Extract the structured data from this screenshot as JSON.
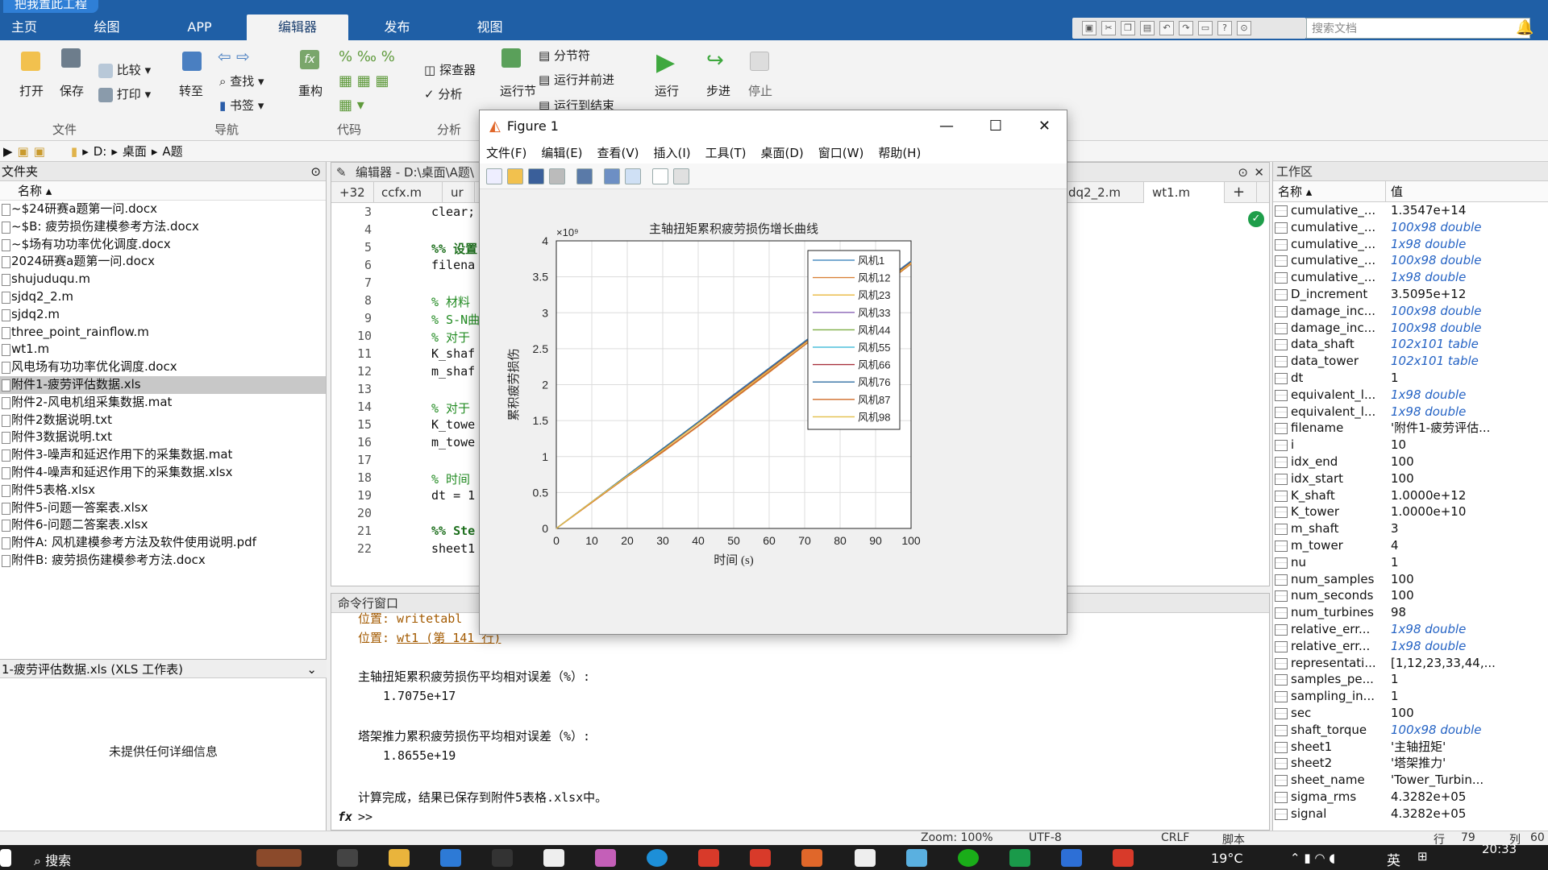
{
  "app": {
    "title_tag": "把我置此工程"
  },
  "tabs": [
    {
      "label": "主页",
      "active": false
    },
    {
      "label": "绘图",
      "active": false
    },
    {
      "label": "APP",
      "active": false
    },
    {
      "label": "编辑器",
      "active": true
    },
    {
      "label": "发布",
      "active": false
    },
    {
      "label": "视图",
      "active": false
    }
  ],
  "search": {
    "placeholder": "搜索文档"
  },
  "ribbon": {
    "open": "打开",
    "save": "保存",
    "compare": "比较",
    "print": "打印",
    "goto": "转至",
    "find": "查找",
    "bookmark": "书签",
    "refactor": "重构",
    "profiler": "探查器",
    "analyze": "分析",
    "run_section": "运行节",
    "section_break": "分节符",
    "run_advance": "运行并前进",
    "run_to_end": "运行到结束",
    "run": "运行",
    "step": "步进",
    "stop": "停止",
    "groups": [
      "文件",
      "导航",
      "代码",
      "分析"
    ]
  },
  "address": {
    "drive": "D:",
    "folder1": "桌面",
    "folder2": "A题"
  },
  "file_panel": {
    "title": "文件夹",
    "col_name": "名称",
    "files": [
      {
        "name": "~$24研赛a题第一问.docx",
        "selected": false
      },
      {
        "name": "~$B: 疲劳损伤建模参考方法.docx",
        "selected": false
      },
      {
        "name": "~$场有功功率优化调度.docx",
        "selected": false
      },
      {
        "name": "2024研赛a题第一问.docx",
        "selected": false
      },
      {
        "name": "shujuduqu.m",
        "selected": false
      },
      {
        "name": "sjdq2_2.m",
        "selected": false
      },
      {
        "name": "sjdq2.m",
        "selected": false
      },
      {
        "name": "three_point_rainflow.m",
        "selected": false
      },
      {
        "name": "wt1.m",
        "selected": false
      },
      {
        "name": "风电场有功功率优化调度.docx",
        "selected": false
      },
      {
        "name": "附件1-疲劳评估数据.xls",
        "selected": true
      },
      {
        "name": "附件2-风电机组采集数据.mat",
        "selected": false
      },
      {
        "name": "附件2数据说明.txt",
        "selected": false
      },
      {
        "name": "附件3数据说明.txt",
        "selected": false
      },
      {
        "name": "附件3-噪声和延迟作用下的采集数据.mat",
        "selected": false
      },
      {
        "name": "附件4-噪声和延迟作用下的采集数据.xlsx",
        "selected": false
      },
      {
        "name": "附件5表格.xlsx",
        "selected": false
      },
      {
        "name": "附件5-问题一答案表.xlsx",
        "selected": false
      },
      {
        "name": "附件6-问题二答案表.xlsx",
        "selected": false
      },
      {
        "name": "附件A: 风机建模参考方法及软件使用说明.pdf",
        "selected": false
      },
      {
        "name": "附件B: 疲劳损伤建模参考方法.docx",
        "selected": false
      }
    ],
    "detail_title": "1-疲劳评估数据.xls (XLS 工作表)",
    "detail_text": "未提供任何详细信息"
  },
  "editor": {
    "header": "编辑器 - D:\\桌面\\A题\\",
    "tabs": [
      {
        "label": "+32"
      },
      {
        "label": "ccfx.m"
      },
      {
        "label": "ur"
      },
      {
        "label": "dq2_2.m"
      },
      {
        "label": "wt1.m"
      }
    ],
    "lines": [
      {
        "n": "3",
        "code": "clear;"
      },
      {
        "n": "4",
        "code": ""
      },
      {
        "n": "5",
        "code": "%% 设置"
      },
      {
        "n": "6",
        "code": "filena"
      },
      {
        "n": "7",
        "code": ""
      },
      {
        "n": "8",
        "code": "% 材料"
      },
      {
        "n": "9",
        "code": "% S-N曲"
      },
      {
        "n": "10",
        "code": "% 对于"
      },
      {
        "n": "11",
        "code": "K_shaf"
      },
      {
        "n": "12",
        "code": "m_shaf"
      },
      {
        "n": "13",
        "code": ""
      },
      {
        "n": "14",
        "code": "% 对于"
      },
      {
        "n": "15",
        "code": "K_towe"
      },
      {
        "n": "16",
        "code": "m_towe"
      },
      {
        "n": "17",
        "code": ""
      },
      {
        "n": "18",
        "code": "% 时间"
      },
      {
        "n": "19",
        "code": "dt = 1"
      },
      {
        "n": "20",
        "code": ""
      },
      {
        "n": "21",
        "code": "%% Ste"
      },
      {
        "n": "22",
        "code": "sheet1"
      }
    ]
  },
  "command": {
    "title": "命令行窗口",
    "l1": "位置: writetabl",
    "l2_prefix": "位置: ",
    "l2_link": "wt1",
    "l2_suffix": " (第 141 行)",
    "l3": "主轴扭矩累积疲劳损伤平均相对误差（%）:",
    "l4": "1.7075e+17",
    "l5": "塔架推力累积疲劳损伤平均相对误差（%）:",
    "l6": "1.8655e+19",
    "l7": "计算完成，结果已保存到附件5表格.xlsx中。",
    "prompt": ">>"
  },
  "workspace": {
    "title": "工作区",
    "col_name": "名称",
    "col_value": "值",
    "vars": [
      {
        "name": "cumulative_...",
        "value": "1.3547e+14",
        "italic": false
      },
      {
        "name": "cumulative_...",
        "value": "100x98 double",
        "italic": true
      },
      {
        "name": "cumulative_...",
        "value": "1x98 double",
        "italic": true
      },
      {
        "name": "cumulative_...",
        "value": "100x98 double",
        "italic": true
      },
      {
        "name": "cumulative_...",
        "value": "1x98 double",
        "italic": true
      },
      {
        "name": "D_increment",
        "value": "3.5095e+12",
        "italic": false
      },
      {
        "name": "damage_inc...",
        "value": "100x98 double",
        "italic": true
      },
      {
        "name": "damage_inc...",
        "value": "100x98 double",
        "italic": true
      },
      {
        "name": "data_shaft",
        "value": "102x101 table",
        "italic": true
      },
      {
        "name": "data_tower",
        "value": "102x101 table",
        "italic": true
      },
      {
        "name": "dt",
        "value": "1",
        "italic": false
      },
      {
        "name": "equivalent_l...",
        "value": "1x98 double",
        "italic": true
      },
      {
        "name": "equivalent_l...",
        "value": "1x98 double",
        "italic": true
      },
      {
        "name": "filename",
        "value": "'附件1-疲劳评估...",
        "italic": false
      },
      {
        "name": "i",
        "value": "10",
        "italic": false
      },
      {
        "name": "idx_end",
        "value": "100",
        "italic": false
      },
      {
        "name": "idx_start",
        "value": "100",
        "italic": false
      },
      {
        "name": "K_shaft",
        "value": "1.0000e+12",
        "italic": false
      },
      {
        "name": "K_tower",
        "value": "1.0000e+10",
        "italic": false
      },
      {
        "name": "m_shaft",
        "value": "3",
        "italic": false
      },
      {
        "name": "m_tower",
        "value": "4",
        "italic": false
      },
      {
        "name": "nu",
        "value": "1",
        "italic": false
      },
      {
        "name": "num_samples",
        "value": "100",
        "italic": false
      },
      {
        "name": "num_seconds",
        "value": "100",
        "italic": false
      },
      {
        "name": "num_turbines",
        "value": "98",
        "italic": false
      },
      {
        "name": "relative_err...",
        "value": "1x98 double",
        "italic": true
      },
      {
        "name": "relative_err...",
        "value": "1x98 double",
        "italic": true
      },
      {
        "name": "representati...",
        "value": "[1,12,23,33,44,...",
        "italic": false
      },
      {
        "name": "samples_pe...",
        "value": "1",
        "italic": false
      },
      {
        "name": "sampling_in...",
        "value": "1",
        "italic": false
      },
      {
        "name": "sec",
        "value": "100",
        "italic": false
      },
      {
        "name": "shaft_torque",
        "value": "100x98 double",
        "italic": true
      },
      {
        "name": "sheet1",
        "value": "'主轴扭矩'",
        "italic": false
      },
      {
        "name": "sheet2",
        "value": "'塔架推力'",
        "italic": false
      },
      {
        "name": "sheet_name",
        "value": "'Tower_Turbin...",
        "italic": false
      },
      {
        "name": "sigma_rms",
        "value": "4.3282e+05",
        "italic": false
      },
      {
        "name": "signal",
        "value": "4.3282e+05",
        "italic": false
      }
    ]
  },
  "statusbar": {
    "zoom": "Zoom: 100%",
    "encoding": "UTF-8",
    "eol": "CRLF",
    "type": "脚本",
    "row_label": "行",
    "row": "79",
    "col_label": "列",
    "col": "60"
  },
  "taskbar": {
    "search": "搜索",
    "temp": "19°C",
    "lang": "英",
    "time": "20:33"
  },
  "figure": {
    "title": "Figure 1",
    "menu": [
      "文件(F)",
      "编辑(E)",
      "查看(V)",
      "插入(I)",
      "工具(T)",
      "桌面(D)",
      "窗口(W)",
      "帮助(H)"
    ]
  },
  "chart_data": {
    "type": "line",
    "title": "主轴扭矩累积疲劳损伤增长曲线",
    "xlabel": "时间 (s)",
    "ylabel": "累积疲劳损伤",
    "exponent_label": "×10⁹",
    "xlim": [
      0,
      100
    ],
    "ylim": [
      0,
      4
    ],
    "xticks": [
      "0",
      "10",
      "20",
      "30",
      "40",
      "50",
      "60",
      "70",
      "80",
      "90",
      "100"
    ],
    "yticks": [
      "0",
      "0.5",
      "1",
      "1.5",
      "2",
      "2.5",
      "3",
      "3.5",
      "4"
    ],
    "grid": true,
    "legend_position": "top-right",
    "x": [
      0,
      10,
      20,
      30,
      40,
      50,
      60,
      70,
      80,
      90,
      100
    ],
    "series": [
      {
        "name": "风机1",
        "color": "#4d8fc4",
        "values": [
          0,
          0.37,
          0.74,
          1.11,
          1.48,
          1.86,
          2.23,
          2.6,
          2.97,
          3.34,
          3.72
        ]
      },
      {
        "name": "风机12",
        "color": "#d9823a",
        "values": [
          0,
          0.36,
          0.72,
          1.06,
          1.42,
          1.8,
          2.17,
          2.55,
          2.92,
          3.3,
          3.68
        ]
      },
      {
        "name": "风机23",
        "color": "#e8b73c",
        "values": [
          0,
          0.37,
          0.73,
          1.09,
          1.46,
          1.83,
          2.2,
          2.58,
          2.95,
          3.32,
          3.7
        ]
      },
      {
        "name": "风机33",
        "color": "#8a63b5",
        "values": [
          0,
          0.37,
          0.74,
          1.1,
          1.47,
          1.85,
          2.22,
          2.59,
          2.96,
          3.33,
          3.71
        ]
      },
      {
        "name": "风机44",
        "color": "#7fae47",
        "values": [
          0,
          0.37,
          0.74,
          1.1,
          1.47,
          1.85,
          2.22,
          2.59,
          2.96,
          3.33,
          3.71
        ]
      },
      {
        "name": "风机55",
        "color": "#4fbfdc",
        "values": [
          0,
          0.37,
          0.74,
          1.11,
          1.48,
          1.85,
          2.23,
          2.6,
          2.97,
          3.34,
          3.72
        ]
      },
      {
        "name": "风机66",
        "color": "#a8323e",
        "values": [
          0,
          0.37,
          0.73,
          1.1,
          1.47,
          1.84,
          2.21,
          2.58,
          2.95,
          3.33,
          3.7
        ]
      },
      {
        "name": "风机76",
        "color": "#2f6ea3",
        "values": [
          0,
          0.37,
          0.74,
          1.11,
          1.48,
          1.86,
          2.23,
          2.6,
          2.98,
          3.35,
          3.72
        ]
      },
      {
        "name": "风机87",
        "color": "#d06b2a",
        "values": [
          0,
          0.36,
          0.72,
          1.07,
          1.43,
          1.81,
          2.18,
          2.55,
          2.93,
          3.3,
          3.68
        ]
      },
      {
        "name": "风机98",
        "color": "#e3c04a",
        "values": [
          0,
          0.37,
          0.73,
          1.09,
          1.46,
          1.83,
          2.2,
          2.57,
          2.94,
          3.32,
          3.69
        ]
      }
    ]
  }
}
